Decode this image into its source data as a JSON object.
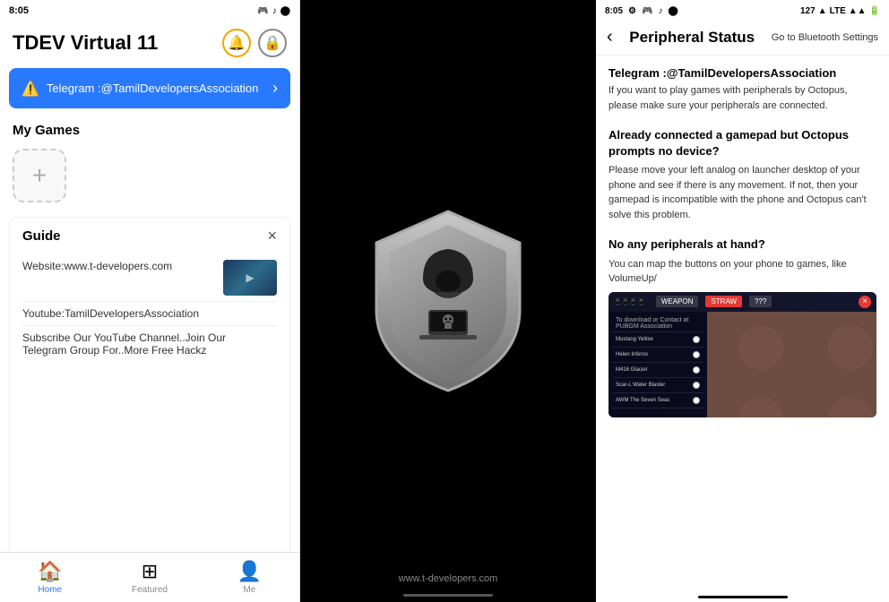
{
  "left": {
    "status_bar": {
      "time": "8:05",
      "icons": [
        "game-icon",
        "music-icon",
        "circle-icon"
      ]
    },
    "header": {
      "title": "TDEV Virtual 11",
      "bell_icon": "🔔",
      "lock_icon": "🔒"
    },
    "telegram_banner": {
      "icon": "⚠",
      "text": "Telegram :@TamilDevelopersAssociation",
      "chevron": "›"
    },
    "my_games": {
      "label": "My Games",
      "add_label": "+"
    },
    "guide": {
      "title": "Guide",
      "close": "×",
      "items": [
        {
          "text": "Website:www.t-developers.com",
          "has_thumb": true
        },
        {
          "text": "Youtube:TamilDevelopersAssociation",
          "has_thumb": false
        },
        {
          "text": "Subscribe Our YouTube Channel..Join Our Telegram Group For..More Free Hackz",
          "has_thumb": false
        }
      ]
    },
    "nav": {
      "items": [
        {
          "icon": "🏠",
          "label": "Home",
          "active": true
        },
        {
          "icon": "⊞",
          "label": "Featured",
          "active": false
        },
        {
          "icon": "👤",
          "label": "Me",
          "active": false
        }
      ]
    }
  },
  "middle": {
    "footer_text": "www.t-developers.com"
  },
  "right": {
    "status_bar": {
      "time": "8:05",
      "icons": [
        "settings-icon",
        "game-icon",
        "music-icon",
        "circle-icon"
      ],
      "battery": "127",
      "signal": "LTE"
    },
    "header": {
      "back_icon": "‹",
      "title": "Peripheral Status",
      "bluetooth_link": "Go to Bluetooth Settings"
    },
    "sections": [
      {
        "id": "telegram",
        "title": "Telegram :@TamilDevelopersAssociation",
        "body": "If you want to play games with peripherals by Octopus, please make sure your peripherals are connected."
      },
      {
        "id": "gamepad",
        "title": "Already connected a gamepad but Octopus prompts no device?",
        "body": "Please move your left analog on launcher desktop of your phone and see if there is any movement. If not, then your gamepad is incompatible with the phone and Octopus can't solve this problem."
      },
      {
        "id": "no-peripheral",
        "title": "No any peripherals at hand?",
        "body": "You can map the buttons on your phone to games, like VolumeUp/"
      }
    ],
    "game_screenshot": {
      "tabs": [
        "WEAPON",
        "STRAW",
        "???"
      ],
      "weapons": [
        "Mustang Yellow",
        "Helen Inferno",
        "M416 Glacier",
        "Scar-L Water Blaster",
        "AWM The Seven Seas"
      ]
    }
  }
}
